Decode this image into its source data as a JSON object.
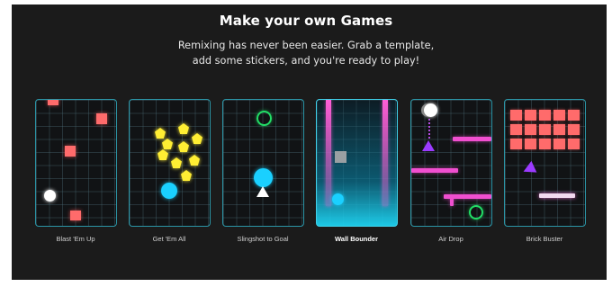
{
  "header": {
    "title": "Make your own Games",
    "subtitle_line1": "Remixing has never been easier. Grab a template,",
    "subtitle_line2": "add some stickers, and you're ready to play!"
  },
  "templates": [
    {
      "label": "Blast 'Em Up"
    },
    {
      "label": "Get 'Em All"
    },
    {
      "label": "Slingshot to Goal"
    },
    {
      "label": "Wall Bounder"
    },
    {
      "label": "Air Drop"
    },
    {
      "label": "Brick Buster"
    }
  ],
  "colors": {
    "panel_bg": "#1b1b1b",
    "card_border": "#2b95a6",
    "red": "#ff6b6b",
    "yellow": "#ffee33",
    "cyan": "#1ad0ff",
    "green": "#22dd66",
    "purple": "#9b3bff",
    "pink": "#f04fd0"
  }
}
